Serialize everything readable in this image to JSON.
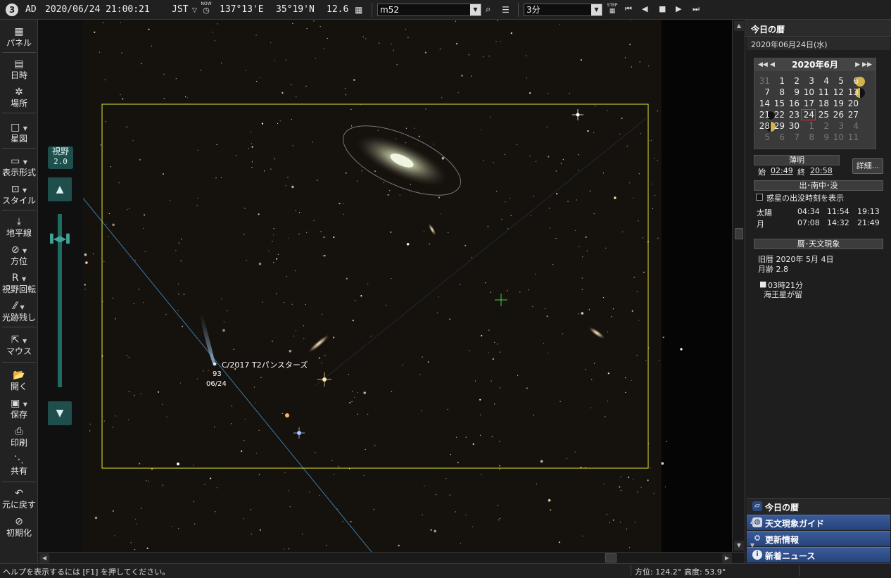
{
  "topbar": {
    "logo": "3",
    "era": "AD",
    "datetime": "2020/06/24 21:00:21",
    "timezone": "JST",
    "tz_dropdown_glyph": "▽",
    "now_label": "NOW",
    "longitude": "137°13'E",
    "latitude": "35°19'N",
    "elevation": "12.6",
    "search_value": "m52",
    "step_value": "3分",
    "step_label": "STEP"
  },
  "toolbar": {
    "panel": "パネル",
    "datetime": "日時",
    "location": "場所",
    "starmap": "星図",
    "display_format": "表示形式",
    "style": "スタイル",
    "horizon": "地平線",
    "direction": "方位",
    "rotate": "視野回転",
    "trail": "光跡残し",
    "mouse": "マウス",
    "open": "開く",
    "save": "保存",
    "print": "印刷",
    "share": "共有",
    "undo": "元に戻す",
    "reset": "初期化"
  },
  "fov": {
    "label": "視野",
    "value": "2.0"
  },
  "sky": {
    "comet_name": "C/2017 T2パンスターズ",
    "comet_mag": "93",
    "comet_date": "06/24"
  },
  "panel": {
    "title": "今日の暦",
    "date": "2020年06月24日(水)",
    "calendar_title": "2020年6月",
    "calendar_days": [
      {
        "d": "31",
        "dim": true
      },
      {
        "d": "1"
      },
      {
        "d": "2"
      },
      {
        "d": "3"
      },
      {
        "d": "4"
      },
      {
        "d": "5"
      },
      {
        "d": "6"
      },
      {
        "d": "7"
      },
      {
        "d": "8"
      },
      {
        "d": "9"
      },
      {
        "d": "10"
      },
      {
        "d": "11"
      },
      {
        "d": "12"
      },
      {
        "d": "13"
      },
      {
        "d": "14"
      },
      {
        "d": "15"
      },
      {
        "d": "16"
      },
      {
        "d": "17"
      },
      {
        "d": "18"
      },
      {
        "d": "19"
      },
      {
        "d": "20"
      },
      {
        "d": "21"
      },
      {
        "d": "22"
      },
      {
        "d": "23"
      },
      {
        "d": "24",
        "today": true
      },
      {
        "d": "25"
      },
      {
        "d": "26"
      },
      {
        "d": "27"
      },
      {
        "d": "28"
      },
      {
        "d": "29"
      },
      {
        "d": "30"
      },
      {
        "d": "1",
        "dim": true
      },
      {
        "d": "2",
        "dim": true
      },
      {
        "d": "3",
        "dim": true
      },
      {
        "d": "4",
        "dim": true
      },
      {
        "d": "5",
        "dim": true
      },
      {
        "d": "6",
        "dim": true
      },
      {
        "d": "7",
        "dim": true
      },
      {
        "d": "8",
        "dim": true
      },
      {
        "d": "9",
        "dim": true
      },
      {
        "d": "10",
        "dim": true
      },
      {
        "d": "11",
        "dim": true
      }
    ],
    "twilight_header": "薄明",
    "twilight_start_label": "始",
    "twilight_start": "02:49",
    "twilight_end_label": "終",
    "twilight_end": "20:58",
    "detail_button": "詳細...",
    "rise_set_header": "出･南中･没",
    "planet_checkbox_label": "惑星の出没時刻を表示",
    "sun_label": "太陽",
    "sun_rise": "04:34",
    "sun_transit": "11:54",
    "sun_set": "19:13",
    "moon_label": "月",
    "moon_rise": "07:08",
    "moon_transit": "14:32",
    "moon_set": "21:49",
    "events_header": "暦･天文現象",
    "lunar_calendar": "旧暦 2020年 5月 4日",
    "moon_age": "月齢 2.8",
    "event_time": "03時21分",
    "event_text": "海王星が留",
    "tabs": [
      "今日の暦",
      "天文現象ガイド",
      "更新情報",
      "新着ニュース"
    ]
  },
  "status": {
    "help": "ヘルプを表示するには [F1] を押してください。",
    "azimuth": "方位: 124.2°",
    "altitude": "高度:  53.9°"
  },
  "colors": {
    "accent_teal": "#1e4f4c",
    "fov_frame": "#e6e633",
    "today_outline": "#e03030",
    "tab_blue": "#2f4f8f"
  }
}
